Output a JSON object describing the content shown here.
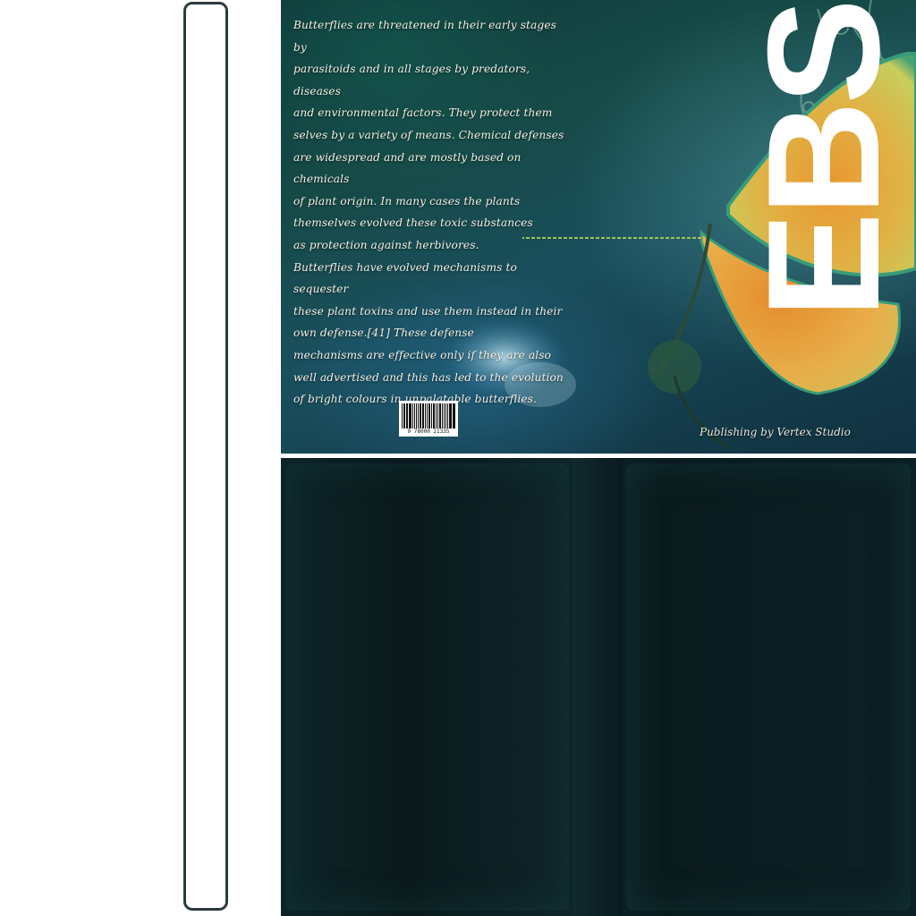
{
  "cover": {
    "back_text": [
      "Butterflies are threatened in their early stages by",
      "parasitoids and in all stages by predators, diseases",
      "and environmental factors. They protect them",
      "selves by a variety of means. Chemical defenses",
      "are widespread and are mostly based on chemicals",
      "of plant origin. In many cases the plants",
      "themselves evolved these toxic substances",
      "as protection against herbivores.",
      "Butterflies have evolved mechanisms to sequester",
      " these plant toxins and use them instead in their",
      "own defense.[41] These defense",
      "mechanisms are effective only if they are also",
      "well advertised and this has led to the evolution",
      "of bright colours in unpalatable butterflies."
    ],
    "title": "EBS",
    "barcode_number": "9 78000 21335",
    "publisher": "Publishing by Vertex Studio"
  },
  "colors": {
    "spine_border": "#2e3b41",
    "title": "#ffffff",
    "wing_orange": "#f0a030",
    "wing_yellow": "#e8d25a",
    "wing_edge": "#3fa07a",
    "lower_panel": "#0c2024"
  },
  "icons": {
    "butterfly": "butterfly-wing-illustration",
    "vine": "decorative-vine-illustration"
  }
}
